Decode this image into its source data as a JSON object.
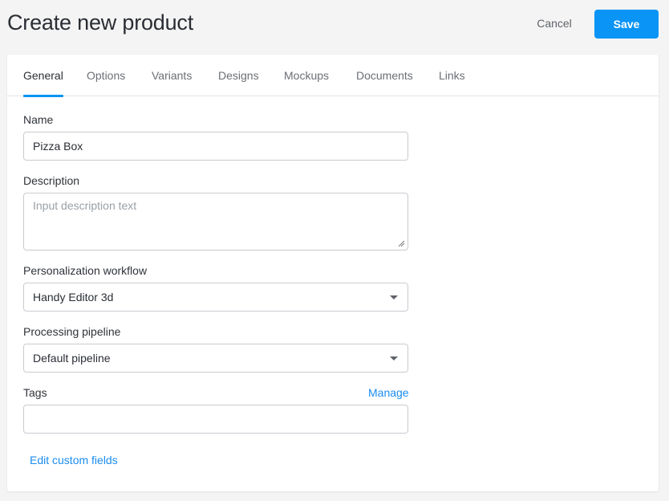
{
  "header": {
    "title": "Create new product",
    "cancel_label": "Cancel",
    "save_label": "Save"
  },
  "colors": {
    "accent": "#0a94f5",
    "link": "#1a8cf0",
    "background": "#f4f4f4"
  },
  "tabs": [
    {
      "label": "General",
      "active": true
    },
    {
      "label": "Options",
      "active": false
    },
    {
      "label": "Variants",
      "active": false
    },
    {
      "label": "Designs",
      "active": false
    },
    {
      "label": "Mockups",
      "active": false
    },
    {
      "label": "Documents",
      "active": false
    },
    {
      "label": "Links",
      "active": false
    }
  ],
  "form": {
    "name": {
      "label": "Name",
      "value": "Pizza Box"
    },
    "description": {
      "label": "Description",
      "value": "",
      "placeholder": "Input description text"
    },
    "personalization_workflow": {
      "label": "Personalization workflow",
      "selected": "Handy Editor 3d"
    },
    "processing_pipeline": {
      "label": "Processing pipeline",
      "selected": "Default pipeline"
    },
    "tags": {
      "label": "Tags",
      "manage_label": "Manage",
      "value": ""
    },
    "edit_custom_fields_label": "Edit custom fields"
  }
}
